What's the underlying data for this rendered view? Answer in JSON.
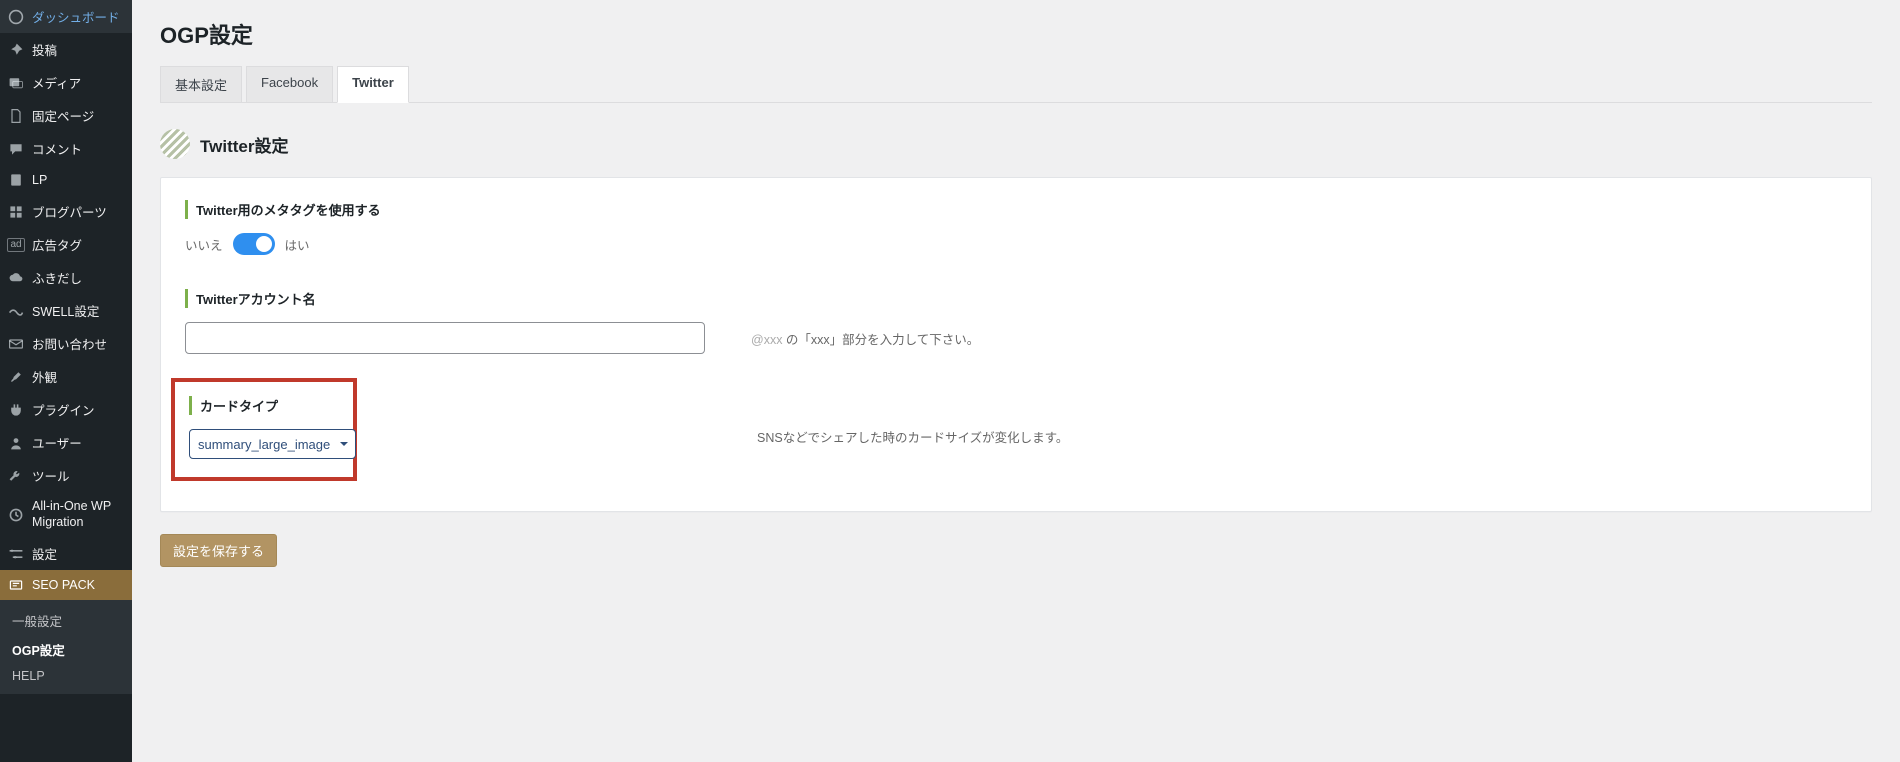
{
  "sidebar": {
    "items": [
      {
        "icon": "dashboard",
        "label": "ダッシュボード"
      },
      {
        "icon": "pin",
        "label": "投稿"
      },
      {
        "icon": "media",
        "label": "メディア"
      },
      {
        "icon": "page",
        "label": "固定ページ"
      },
      {
        "icon": "comment",
        "label": "コメント"
      },
      {
        "icon": "doc",
        "label": "LP"
      },
      {
        "icon": "grid",
        "label": "ブログパーツ"
      },
      {
        "icon": "ad",
        "label": "広告タグ"
      },
      {
        "icon": "cloud",
        "label": "ふきだし"
      },
      {
        "icon": "swell",
        "label": "SWELL設定"
      },
      {
        "icon": "mail",
        "label": "お問い合わせ"
      },
      {
        "icon": "brush",
        "label": "外観"
      },
      {
        "icon": "plugin",
        "label": "プラグイン"
      },
      {
        "icon": "user",
        "label": "ユーザー"
      },
      {
        "icon": "tool",
        "label": "ツール"
      },
      {
        "icon": "migrate",
        "label": "All-in-One WP Migration"
      },
      {
        "icon": "settings",
        "label": "設定"
      },
      {
        "icon": "seo",
        "label": "SEO PACK",
        "active": true
      }
    ],
    "sub": [
      {
        "label": "一般設定"
      },
      {
        "label": "OGP設定",
        "current": true
      },
      {
        "label": "HELP"
      }
    ]
  },
  "page": {
    "title": "OGP設定",
    "tabs": [
      {
        "label": "基本設定"
      },
      {
        "label": "Facebook"
      },
      {
        "label": "Twitter",
        "active": true
      }
    ],
    "section_title": "Twitter設定"
  },
  "fields": {
    "meta_tag": {
      "label": "Twitter用のメタタグを使用する",
      "off": "いいえ",
      "on": "はい"
    },
    "account": {
      "label": "Twitterアカウント名",
      "value": "",
      "help_at": "@xxx",
      "help_rest": " の「xxx」部分を入力して下さい。"
    },
    "card": {
      "label": "カードタイプ",
      "selected": "summary_large_image",
      "help": "SNSなどでシェアした時のカードサイズが変化します。"
    }
  },
  "actions": {
    "save": "設定を保存する"
  }
}
